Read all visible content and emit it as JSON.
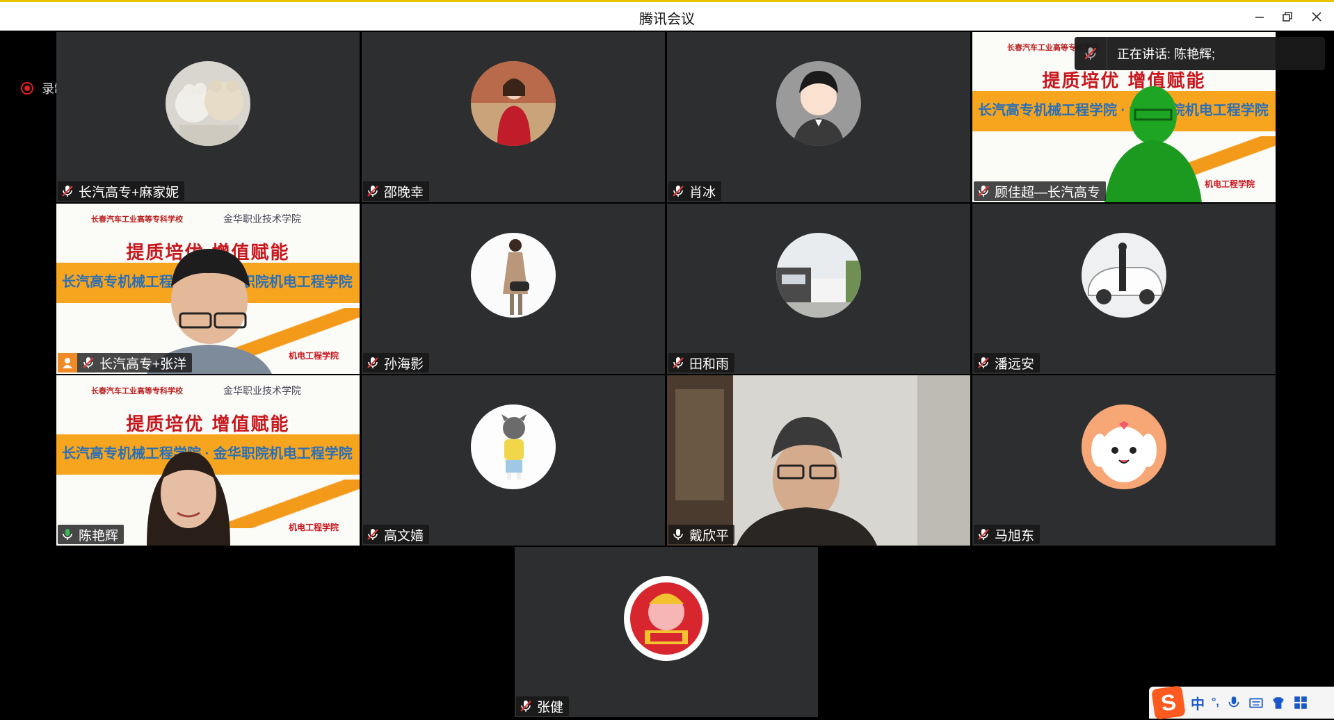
{
  "window": {
    "title": "腾讯会议",
    "buttons": [
      "minimize",
      "restore",
      "close"
    ]
  },
  "recording": {
    "label": "录制中",
    "color": "#e02020"
  },
  "speaking_banner": {
    "label": "正在讲话: 陈艳辉;"
  },
  "participants": [
    {
      "name": "长汽高专+麻家妮",
      "mic": "muted",
      "type": "avatar",
      "avatar": "two-plush-toys"
    },
    {
      "name": "邵晚幸",
      "mic": "muted",
      "type": "avatar",
      "avatar": "woman-red-coat"
    },
    {
      "name": "肖冰",
      "mic": "muted",
      "type": "avatar",
      "avatar": "cartoon-man"
    },
    {
      "name": "顾佳超—长汽高专",
      "mic": "muted",
      "type": "video",
      "video": "green-screen-man-over-slide"
    },
    {
      "name": "长汽高专+张洋",
      "mic": "muted",
      "type": "video",
      "video": "man-glasses-over-slide",
      "badge": "host"
    },
    {
      "name": "孙海影",
      "mic": "muted",
      "type": "avatar",
      "avatar": "woman-illustration"
    },
    {
      "name": "田和雨",
      "mic": "muted",
      "type": "avatar",
      "avatar": "campus-building"
    },
    {
      "name": "潘远安",
      "mic": "muted",
      "type": "avatar",
      "avatar": "white-suv"
    },
    {
      "name": "陈艳辉",
      "mic": "active",
      "type": "video",
      "video": "woman-over-slide",
      "speaking": true
    },
    {
      "name": "高文嫱",
      "mic": "muted",
      "type": "avatar",
      "avatar": "cartoon-cat-child"
    },
    {
      "name": "戴欣平",
      "mic": "on",
      "type": "video",
      "video": "older-man-glasses-room"
    },
    {
      "name": "马旭东",
      "mic": "muted",
      "type": "avatar",
      "avatar": "cartoon-dog"
    },
    {
      "name": "张健",
      "mic": "muted",
      "type": "avatar",
      "avatar": "fortune-god"
    }
  ],
  "slide_text": {
    "school_left": "长春汽车工业高等专科学校",
    "school_right": "金华职业技术学院",
    "headline": "提质培优 增值赋能",
    "band_line": "长汽高专机械工程学院 · 金华职院机电工程学院",
    "footer": "机电工程学院"
  },
  "ime": {
    "logo": "S",
    "lang": "中",
    "punct": "°,"
  },
  "colors": {
    "tile_bg": "#2d2e30",
    "active_border": "#3bbb5a",
    "mic_muted": "#e23a3a",
    "title_border": "#e8c400"
  }
}
